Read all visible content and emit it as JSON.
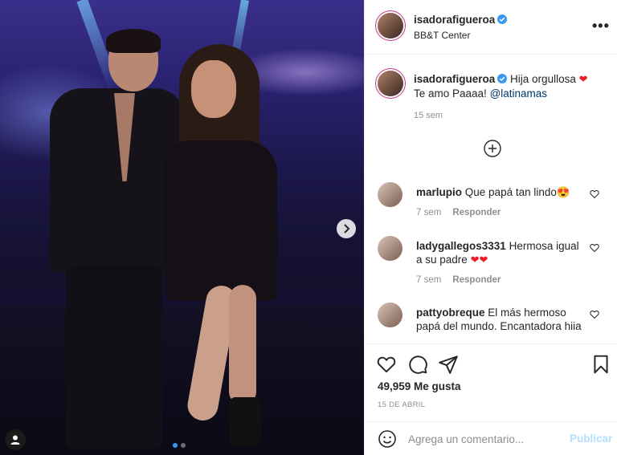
{
  "post": {
    "username": "isadorafigueroa",
    "location": "BB&T Center",
    "more_label": "•••",
    "carousel_dots": 2,
    "carousel_active": 0
  },
  "caption": {
    "username": "isadorafigueroa",
    "text": "Hija orgullosa",
    "emoji": "❤",
    "line2": "Te amo Paaaa!",
    "mention": "@latinamas",
    "time": "15 sem"
  },
  "comments": [
    {
      "username": "marlupio",
      "text": "Que papá tan lindo",
      "emoji": "😍",
      "time": "7 sem",
      "reply": "Responder"
    },
    {
      "username": "ladygallegos3331",
      "text": "Hermosa igual a su padre",
      "emoji": "❤❤",
      "time": "7 sem",
      "reply": "Responder"
    },
    {
      "username": "pattyobreque",
      "text": "El más hermoso papá del mundo. Encantadora hiia",
      "emoji": "",
      "time": "",
      "reply": ""
    }
  ],
  "likes": "49,959 Me gusta",
  "date": "15 DE ABRIL",
  "add_comment": {
    "placeholder": "Agrega un comentario...",
    "post_label": "Publicar"
  },
  "colors": {
    "verified": "#3897f0",
    "heart": "#ed1d24",
    "link": "#00376b",
    "post_disabled": "#b2dffc"
  },
  "icons": [
    "like-icon",
    "comment-icon",
    "share-icon",
    "save-icon",
    "emoji-icon",
    "plus-circle-icon",
    "chevron-right-icon",
    "user-tag-icon",
    "verified-icon",
    "more-icon"
  ]
}
